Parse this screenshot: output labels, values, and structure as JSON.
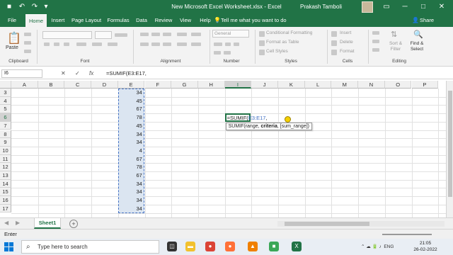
{
  "titlebar": {
    "title": "New Microsoft Excel Worksheet.xlsx  -  Excel",
    "user": "Prakash Tamboli",
    "undo_glyph": "↶",
    "redo_glyph": "↷",
    "save_glyph": "■",
    "qa_more_glyph": "▾",
    "ribbon_options_glyph": "▭",
    "minimize_glyph": "─",
    "maximize_glyph": "□",
    "close_glyph": "✕"
  },
  "tabs": {
    "items": [
      "File",
      "Home",
      "Insert",
      "Page Layout",
      "Formulas",
      "Data",
      "Review",
      "View",
      "Help"
    ],
    "active": "Home",
    "tell_me": "Tell me what you want to do",
    "share": "Share",
    "tell_icon_glyph": "💡",
    "share_icon_glyph": "👤"
  },
  "ribbon": {
    "groups": [
      "Clipboard",
      "Font",
      "Alignment",
      "Number",
      "Styles",
      "Cells",
      "Editing"
    ],
    "paste_label": "Paste",
    "number_format": "General",
    "conditional_formatting": "Conditional Formatting",
    "format_as_table": "Format as Table",
    "cell_styles": "Cell Styles",
    "insert": "Insert",
    "delete": "Delete",
    "format": "Format",
    "sort_filter": "Sort & Filter",
    "find_select": "Find & Select",
    "paste_icon_glyph": "📋",
    "sort_icon_glyph": "⇅",
    "find_icon_glyph": "🔍"
  },
  "formula_bar": {
    "name_box": "I6",
    "formula": "=SUMIF(E3:E17,",
    "cancel_glyph": "✕",
    "enter_glyph": "✓",
    "fx_glyph": "fx"
  },
  "grid": {
    "columns": [
      "A",
      "B",
      "C",
      "D",
      "E",
      "F",
      "G",
      "H",
      "I",
      "J",
      "K",
      "L",
      "M",
      "N",
      "O",
      "P"
    ],
    "selected_column": "I",
    "rows": [
      "3",
      "4",
      "5",
      "6",
      "7",
      "8",
      "9",
      "10",
      "11",
      "12",
      "13",
      "14",
      "15",
      "16",
      "17"
    ],
    "selected_row": "6",
    "column_e_values": [
      "34",
      "45",
      "67",
      "78",
      "45",
      "34",
      "34",
      "4",
      "67",
      "78",
      "67",
      "34",
      "34",
      "34",
      "34"
    ],
    "active_cell_prefix": "=SUMIF(",
    "active_cell_ref": "E3:E17",
    "active_cell_suffix": ",",
    "tooltip_fn": "SUMIF(range, ",
    "tooltip_bold": "criteria",
    "tooltip_rest": ", [sum_range])"
  },
  "sheets": {
    "tabs": [
      "Sheet1"
    ],
    "add_glyph": "+",
    "nav_left_glyph": "◀",
    "nav_right_glyph": "▶"
  },
  "status": {
    "mode": "Enter"
  },
  "taskbar": {
    "search_placeholder": "Type here to search",
    "search_glyph": "⌕",
    "language": "ENG",
    "time": "21:05",
    "date": "26-02-2022",
    "tray_glyphs": "⌃ ☁ 🔋 ♪",
    "icons": [
      {
        "name": "task-view-icon",
        "glyph": "◫",
        "color": "#333333"
      },
      {
        "name": "file-explorer-icon",
        "glyph": "▬",
        "color": "#f2c12e"
      },
      {
        "name": "chrome-icon",
        "glyph": "●",
        "color": "#db4437"
      },
      {
        "name": "firefox-icon",
        "glyph": "●",
        "color": "#ff7139"
      },
      {
        "name": "vlc-icon",
        "glyph": "▲",
        "color": "#f08000"
      },
      {
        "name": "app-icon",
        "glyph": "■",
        "color": "#3aa757"
      },
      {
        "name": "excel-icon",
        "glyph": "X",
        "color": "#217346"
      }
    ]
  }
}
